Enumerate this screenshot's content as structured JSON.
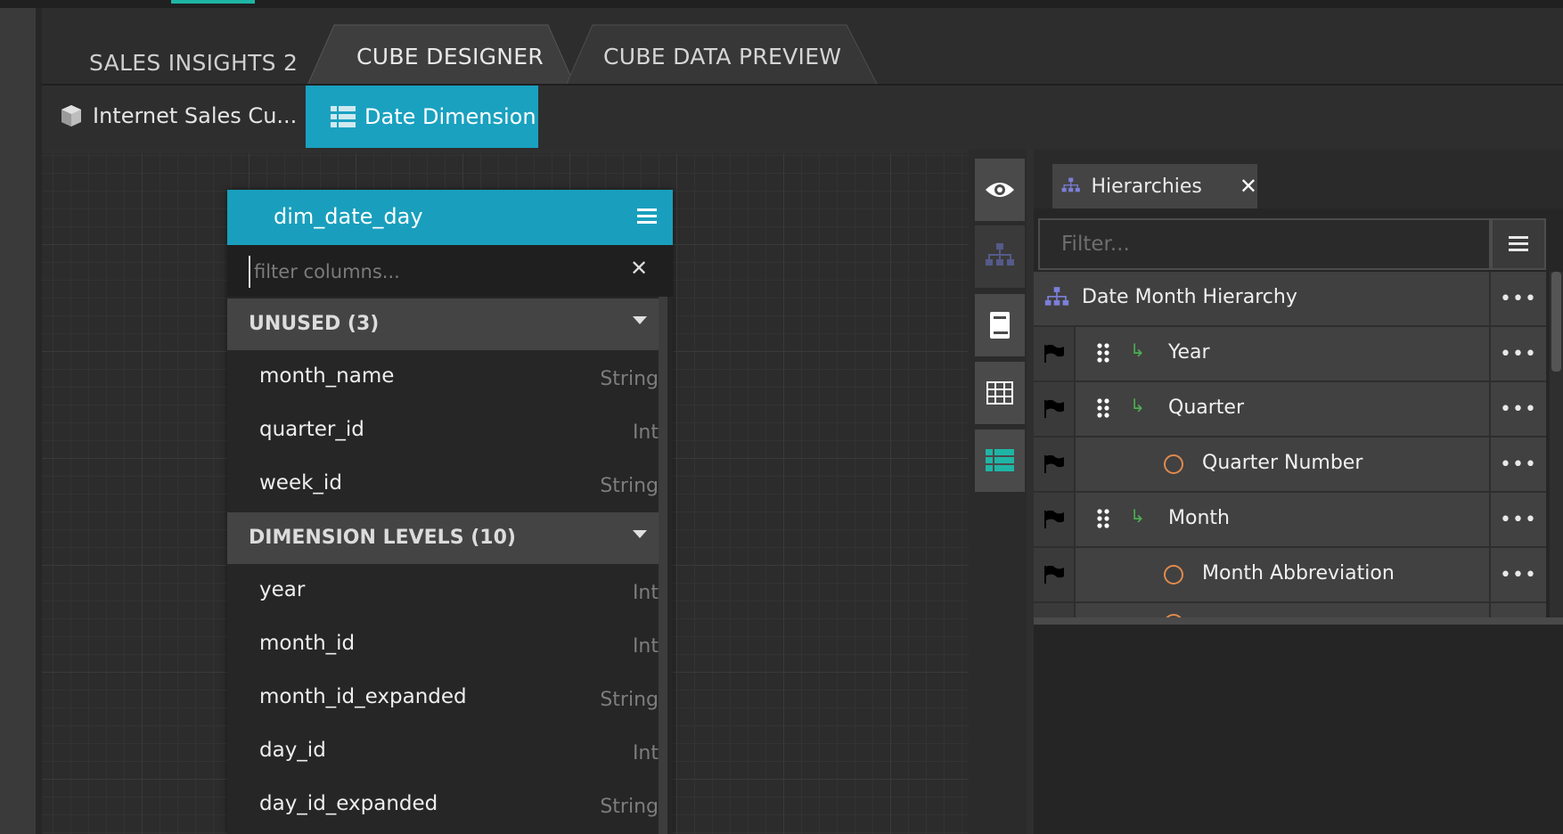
{
  "top_tabs": {
    "sales": "SALES INSIGHTS 2",
    "designer": "CUBE DESIGNER",
    "preview": "CUBE DATA PREVIEW"
  },
  "sub_tabs": {
    "cube": "Internet Sales Cu...",
    "date_dimension": "Date Dimension"
  },
  "table_card": {
    "title": "dim_date_day",
    "filter_placeholder": "filter columns...",
    "sections": [
      {
        "label": "UNUSED (3)",
        "columns": [
          {
            "name": "month_name",
            "type": "String"
          },
          {
            "name": "quarter_id",
            "type": "Int"
          },
          {
            "name": "week_id",
            "type": "String"
          }
        ]
      },
      {
        "label": "DIMENSION LEVELS (10)",
        "columns": [
          {
            "name": "year",
            "type": "Int"
          },
          {
            "name": "month_id",
            "type": "Int"
          },
          {
            "name": "month_id_expanded",
            "type": "String"
          },
          {
            "name": "day_id",
            "type": "Int"
          },
          {
            "name": "day_id_expanded",
            "type": "String"
          }
        ]
      }
    ]
  },
  "hierarchies_panel": {
    "tab_label": "Hierarchies",
    "filter_placeholder": "Filter...",
    "hierarchy_name": "Date Month Hierarchy",
    "more_label": "•••",
    "items": [
      {
        "label": "Year",
        "kind": "level"
      },
      {
        "label": "Quarter",
        "kind": "level"
      },
      {
        "label": "Quarter Number",
        "kind": "attribute"
      },
      {
        "label": "Month",
        "kind": "level"
      },
      {
        "label": "Month Abbreviation",
        "kind": "attribute"
      }
    ]
  },
  "colors": {
    "accent_blue": "#1aa1c0",
    "accent_teal": "#1fb5a5",
    "hierarchy_icon": "#7b7fd9",
    "attribute_circle": "#e08a4e",
    "level_arrow": "#4caf50"
  }
}
